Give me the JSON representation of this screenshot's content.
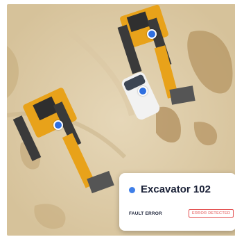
{
  "colors": {
    "status_dot": "#3f7fe8",
    "marker": "#2f6fe0",
    "error": "#e24b4b"
  },
  "map": {
    "markers": [
      "excavator-marker",
      "van-marker",
      "excavator-marker"
    ]
  },
  "card": {
    "title": "Excavator 102",
    "label": "FAULT ERROR",
    "badge": "ERROR DETECTED"
  }
}
